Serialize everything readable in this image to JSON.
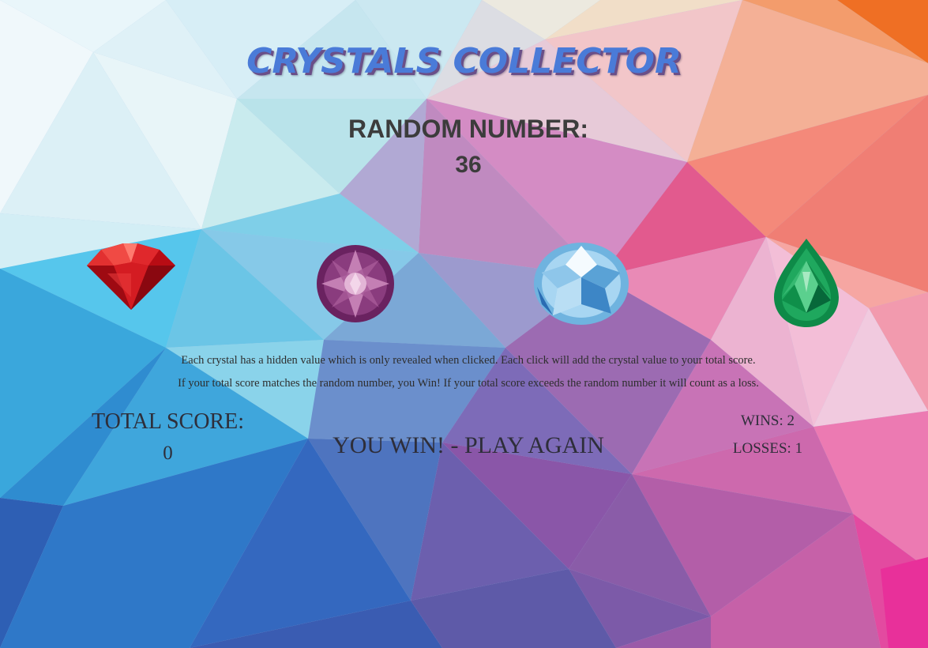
{
  "header": {
    "title": "CRYSTALS COLLECTOR"
  },
  "target": {
    "label": "RANDOM NUMBER:",
    "value": "36"
  },
  "crystals": [
    {
      "name": "red crystal",
      "color": "#d0141a"
    },
    {
      "name": "purple crystal",
      "color": "#7a2e6e"
    },
    {
      "name": "blue crystal",
      "color": "#8cc6ea"
    },
    {
      "name": "green crystal",
      "color": "#1a9a54"
    }
  ],
  "instructions": {
    "line1": "Each crystal has a hidden value which is only revealed when clicked. Each click will add the crystal value to your total score.",
    "line2": "If your total score matches the random number, you Win! If your total score exceeds the random number it will count as a loss."
  },
  "score": {
    "label": "TOTAL SCORE:",
    "value": "0"
  },
  "status": {
    "message": "YOU WIN! - PLAY AGAIN"
  },
  "record": {
    "wins": "WINS: 2",
    "losses": "LOSSES: 1"
  }
}
